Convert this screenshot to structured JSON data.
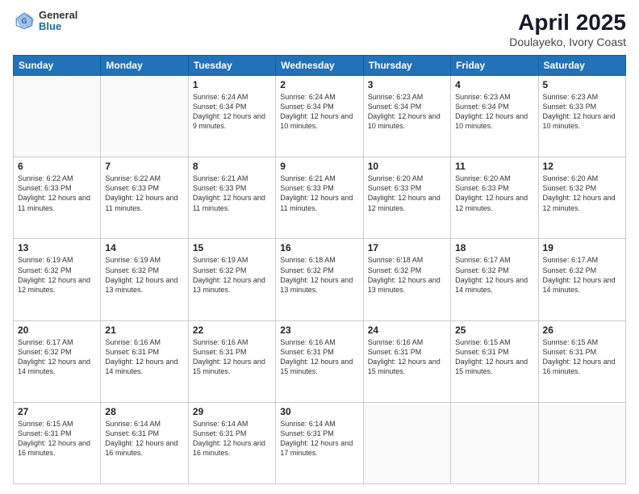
{
  "header": {
    "logo": {
      "general": "General",
      "blue": "Blue"
    },
    "title": "April 2025",
    "subtitle": "Doulayeko, Ivory Coast"
  },
  "calendar": {
    "days_of_week": [
      "Sunday",
      "Monday",
      "Tuesday",
      "Wednesday",
      "Thursday",
      "Friday",
      "Saturday"
    ],
    "weeks": [
      [
        {
          "day": "",
          "info": ""
        },
        {
          "day": "",
          "info": ""
        },
        {
          "day": "1",
          "info": "Sunrise: 6:24 AM\nSunset: 6:34 PM\nDaylight: 12 hours and 9 minutes."
        },
        {
          "day": "2",
          "info": "Sunrise: 6:24 AM\nSunset: 6:34 PM\nDaylight: 12 hours and 10 minutes."
        },
        {
          "day": "3",
          "info": "Sunrise: 6:23 AM\nSunset: 6:34 PM\nDaylight: 12 hours and 10 minutes."
        },
        {
          "day": "4",
          "info": "Sunrise: 6:23 AM\nSunset: 6:34 PM\nDaylight: 12 hours and 10 minutes."
        },
        {
          "day": "5",
          "info": "Sunrise: 6:23 AM\nSunset: 6:33 PM\nDaylight: 12 hours and 10 minutes."
        }
      ],
      [
        {
          "day": "6",
          "info": "Sunrise: 6:22 AM\nSunset: 6:33 PM\nDaylight: 12 hours and 11 minutes."
        },
        {
          "day": "7",
          "info": "Sunrise: 6:22 AM\nSunset: 6:33 PM\nDaylight: 12 hours and 11 minutes."
        },
        {
          "day": "8",
          "info": "Sunrise: 6:21 AM\nSunset: 6:33 PM\nDaylight: 12 hours and 11 minutes."
        },
        {
          "day": "9",
          "info": "Sunrise: 6:21 AM\nSunset: 6:33 PM\nDaylight: 12 hours and 11 minutes."
        },
        {
          "day": "10",
          "info": "Sunrise: 6:20 AM\nSunset: 6:33 PM\nDaylight: 12 hours and 12 minutes."
        },
        {
          "day": "11",
          "info": "Sunrise: 6:20 AM\nSunset: 6:33 PM\nDaylight: 12 hours and 12 minutes."
        },
        {
          "day": "12",
          "info": "Sunrise: 6:20 AM\nSunset: 6:32 PM\nDaylight: 12 hours and 12 minutes."
        }
      ],
      [
        {
          "day": "13",
          "info": "Sunrise: 6:19 AM\nSunset: 6:32 PM\nDaylight: 12 hours and 12 minutes."
        },
        {
          "day": "14",
          "info": "Sunrise: 6:19 AM\nSunset: 6:32 PM\nDaylight: 12 hours and 13 minutes."
        },
        {
          "day": "15",
          "info": "Sunrise: 6:19 AM\nSunset: 6:32 PM\nDaylight: 12 hours and 13 minutes."
        },
        {
          "day": "16",
          "info": "Sunrise: 6:18 AM\nSunset: 6:32 PM\nDaylight: 12 hours and 13 minutes."
        },
        {
          "day": "17",
          "info": "Sunrise: 6:18 AM\nSunset: 6:32 PM\nDaylight: 12 hours and 13 minutes."
        },
        {
          "day": "18",
          "info": "Sunrise: 6:17 AM\nSunset: 6:32 PM\nDaylight: 12 hours and 14 minutes."
        },
        {
          "day": "19",
          "info": "Sunrise: 6:17 AM\nSunset: 6:32 PM\nDaylight: 12 hours and 14 minutes."
        }
      ],
      [
        {
          "day": "20",
          "info": "Sunrise: 6:17 AM\nSunset: 6:32 PM\nDaylight: 12 hours and 14 minutes."
        },
        {
          "day": "21",
          "info": "Sunrise: 6:16 AM\nSunset: 6:31 PM\nDaylight: 12 hours and 14 minutes."
        },
        {
          "day": "22",
          "info": "Sunrise: 6:16 AM\nSunset: 6:31 PM\nDaylight: 12 hours and 15 minutes."
        },
        {
          "day": "23",
          "info": "Sunrise: 6:16 AM\nSunset: 6:31 PM\nDaylight: 12 hours and 15 minutes."
        },
        {
          "day": "24",
          "info": "Sunrise: 6:16 AM\nSunset: 6:31 PM\nDaylight: 12 hours and 15 minutes."
        },
        {
          "day": "25",
          "info": "Sunrise: 6:15 AM\nSunset: 6:31 PM\nDaylight: 12 hours and 15 minutes."
        },
        {
          "day": "26",
          "info": "Sunrise: 6:15 AM\nSunset: 6:31 PM\nDaylight: 12 hours and 16 minutes."
        }
      ],
      [
        {
          "day": "27",
          "info": "Sunrise: 6:15 AM\nSunset: 6:31 PM\nDaylight: 12 hours and 16 minutes."
        },
        {
          "day": "28",
          "info": "Sunrise: 6:14 AM\nSunset: 6:31 PM\nDaylight: 12 hours and 16 minutes."
        },
        {
          "day": "29",
          "info": "Sunrise: 6:14 AM\nSunset: 6:31 PM\nDaylight: 12 hours and 16 minutes."
        },
        {
          "day": "30",
          "info": "Sunrise: 6:14 AM\nSunset: 6:31 PM\nDaylight: 12 hours and 17 minutes."
        },
        {
          "day": "",
          "info": ""
        },
        {
          "day": "",
          "info": ""
        },
        {
          "day": "",
          "info": ""
        }
      ]
    ]
  }
}
